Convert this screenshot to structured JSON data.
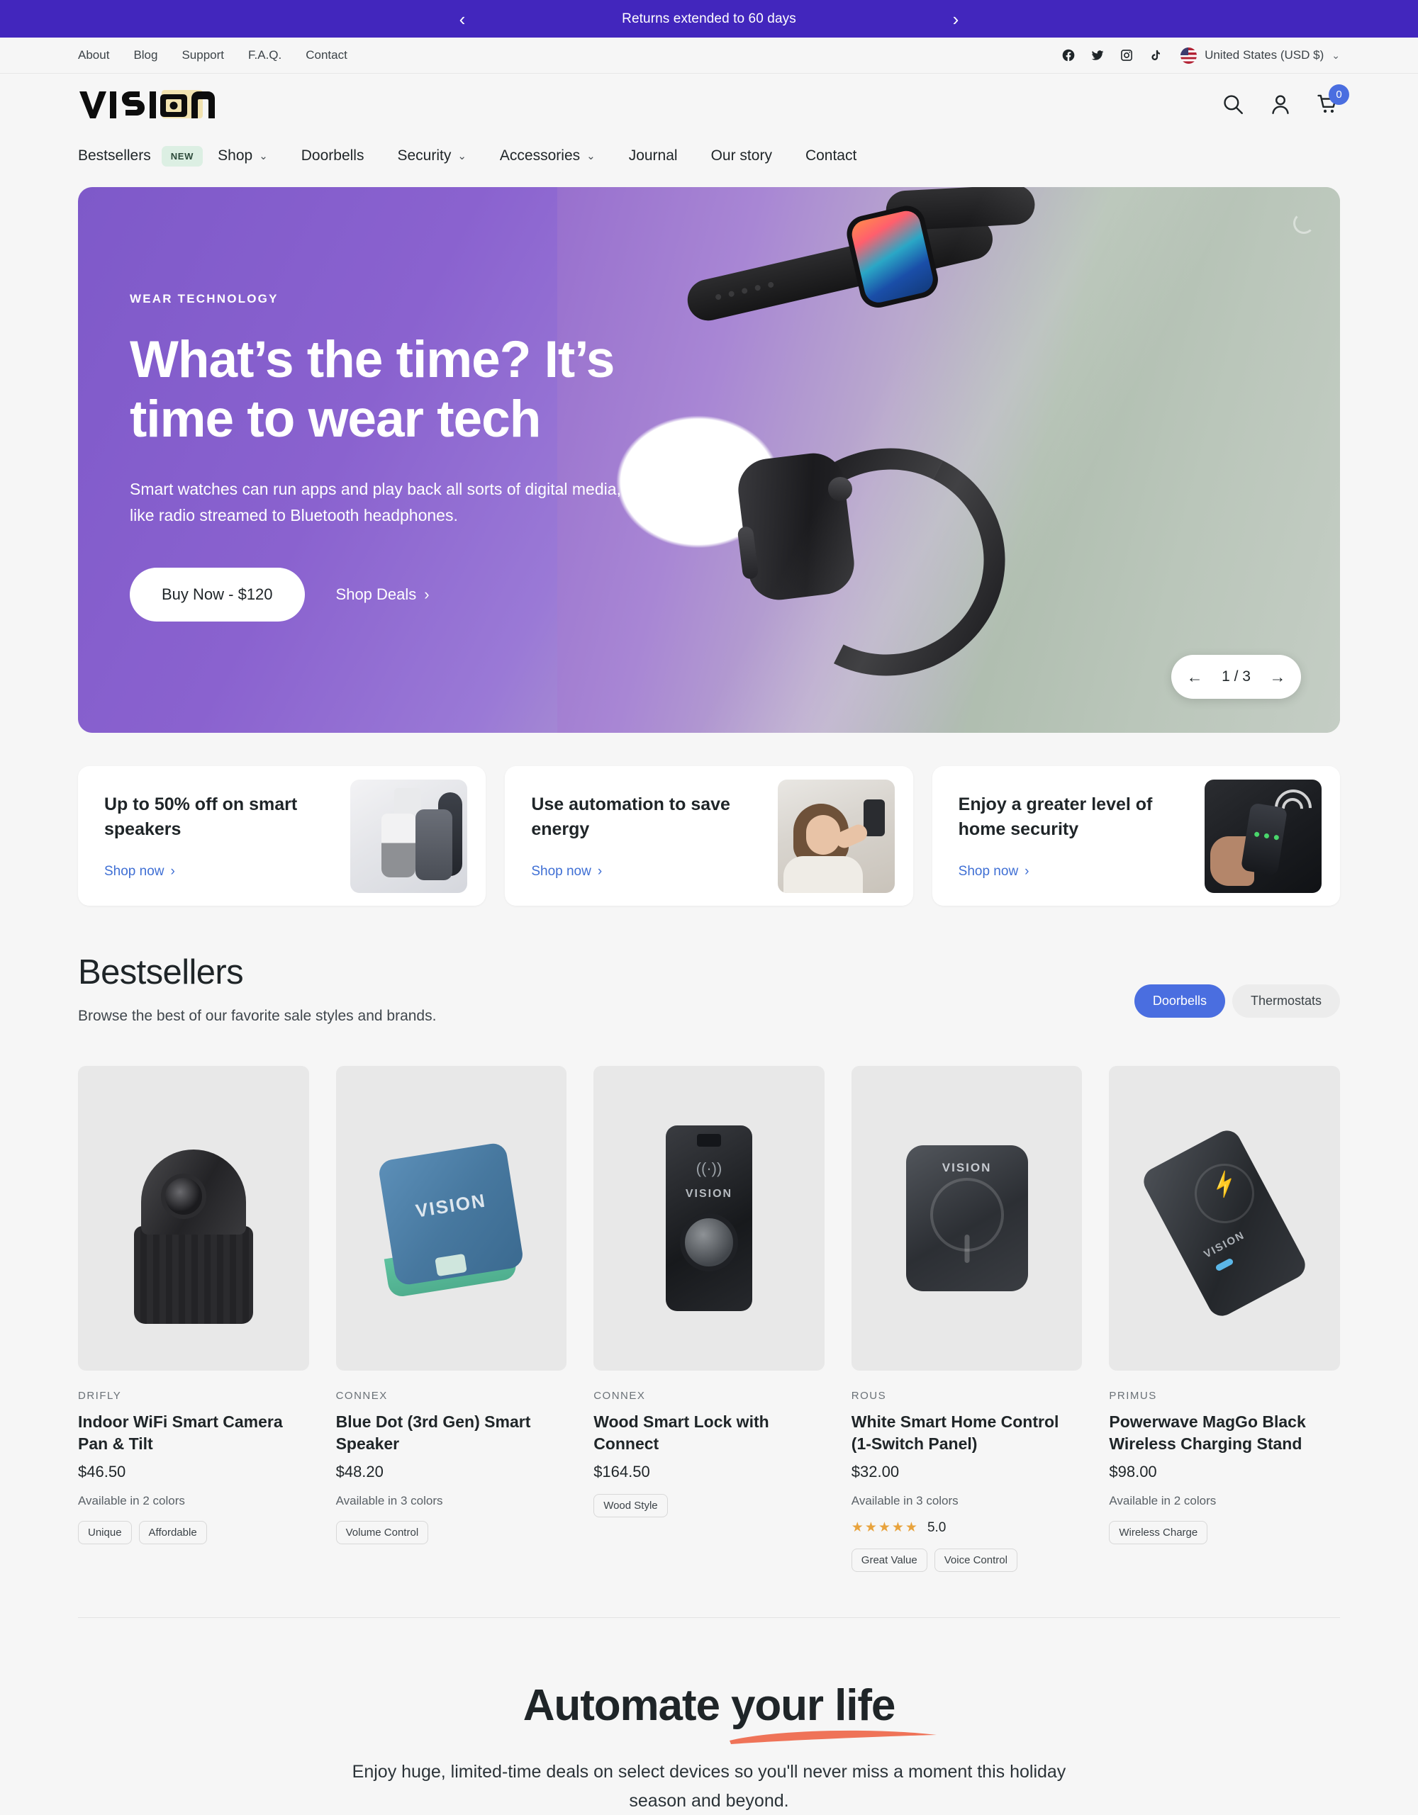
{
  "announcement": {
    "text": "Returns extended to 60 days",
    "prev": "‹",
    "next": "›"
  },
  "utility": {
    "links": [
      "About",
      "Blog",
      "Support",
      "F.A.Q.",
      "Contact"
    ],
    "social": [
      "facebook-icon",
      "twitter-icon",
      "instagram-icon",
      "tiktok-icon"
    ],
    "country": "United States (USD $)",
    "chevron": "⌄"
  },
  "header": {
    "logo": "VISION",
    "icons": [
      "search-icon",
      "account-icon",
      "cart-icon"
    ],
    "cart_count": "0"
  },
  "nav": {
    "items": [
      {
        "label": "Bestsellers",
        "badge": "NEW",
        "caret": ""
      },
      {
        "label": "Shop",
        "badge": "",
        "caret": "⌄"
      },
      {
        "label": "Doorbells",
        "badge": "",
        "caret": ""
      },
      {
        "label": "Security",
        "badge": "",
        "caret": "⌄"
      },
      {
        "label": "Accessories",
        "badge": "",
        "caret": "⌄"
      },
      {
        "label": "Journal",
        "badge": "",
        "caret": ""
      },
      {
        "label": "Our story",
        "badge": "",
        "caret": ""
      },
      {
        "label": "Contact",
        "badge": "",
        "caret": ""
      }
    ]
  },
  "hero": {
    "eyebrow": "WEAR TECHNOLOGY",
    "title": "What’s the time? It’s time to wear tech",
    "subtitle": "Smart watches can run apps and play back all sorts of digital media, like radio streamed to Bluetooth headphones.",
    "cta_primary": "Buy Now - $120",
    "cta_secondary": "Shop Deals",
    "cta_secondary_caret": "›",
    "slide_counter": "1 / 3",
    "prev_arrow": "←",
    "next_arrow": "→"
  },
  "promos": [
    {
      "title": "Up to 50% off on smart speakers",
      "link": "Shop now",
      "caret": "›",
      "image": "smart-speakers-photo"
    },
    {
      "title": "Use automation to save energy",
      "link": "Shop now",
      "caret": "›",
      "image": "woman-thermostat-photo"
    },
    {
      "title": "Enjoy a greater level of home security",
      "link": "Shop now",
      "caret": "›",
      "image": "smart-lock-photo"
    }
  ],
  "bestsellers": {
    "title": "Bestsellers",
    "subtitle": "Browse the best of our favorite sale styles and brands.",
    "filters": [
      {
        "label": "Doorbells",
        "active": true
      },
      {
        "label": "Thermostats",
        "active": false
      }
    ],
    "products": [
      {
        "brand": "DRIFLY",
        "name": "Indoor WiFi Smart Camera Pan & Tilt",
        "price": "$46.50",
        "colors": "Available in 2 colors",
        "rating": "",
        "stars": "",
        "tags": [
          "Unique",
          "Affordable"
        ]
      },
      {
        "brand": "CONNEX",
        "name": "Blue Dot (3rd Gen) Smart Speaker",
        "price": "$48.20",
        "colors": "Available in 3 colors",
        "rating": "",
        "stars": "",
        "tags": [
          "Volume Control"
        ]
      },
      {
        "brand": "CONNEX",
        "name": "Wood Smart Lock with Connect",
        "price": "$164.50",
        "colors": "",
        "rating": "",
        "stars": "",
        "tags": [
          "Wood Style"
        ]
      },
      {
        "brand": "ROUS",
        "name": "White Smart Home Control (1-Switch Panel)",
        "price": "$32.00",
        "colors": "Available in 3 colors",
        "rating": "5.0",
        "stars": "★★★★★",
        "tags": [
          "Great Value",
          "Voice Control"
        ]
      },
      {
        "brand": "PRIMUS",
        "name": "Powerwave MagGo Black Wireless Charging Stand",
        "price": "$98.00",
        "colors": "Available in 2 colors",
        "rating": "",
        "stars": "",
        "tags": [
          "Wireless Charge"
        ]
      }
    ]
  },
  "automate": {
    "title_first": "Automate ",
    "title_highlight": "your life",
    "subtitle": "Enjoy huge, limited-time deals on select devices so you'll never miss a moment this holiday season and beyond."
  },
  "colors": {
    "announcement_bg": "#4226bd",
    "page_bg": "#f6f6f6",
    "accent_blue": "#4a6ee0",
    "link_blue": "#3f6fd4",
    "badge_green_bg": "#dcefe3",
    "swoosh": "#ef7358",
    "star": "#e8a33d",
    "logo_accent": "#f2e3b0"
  }
}
